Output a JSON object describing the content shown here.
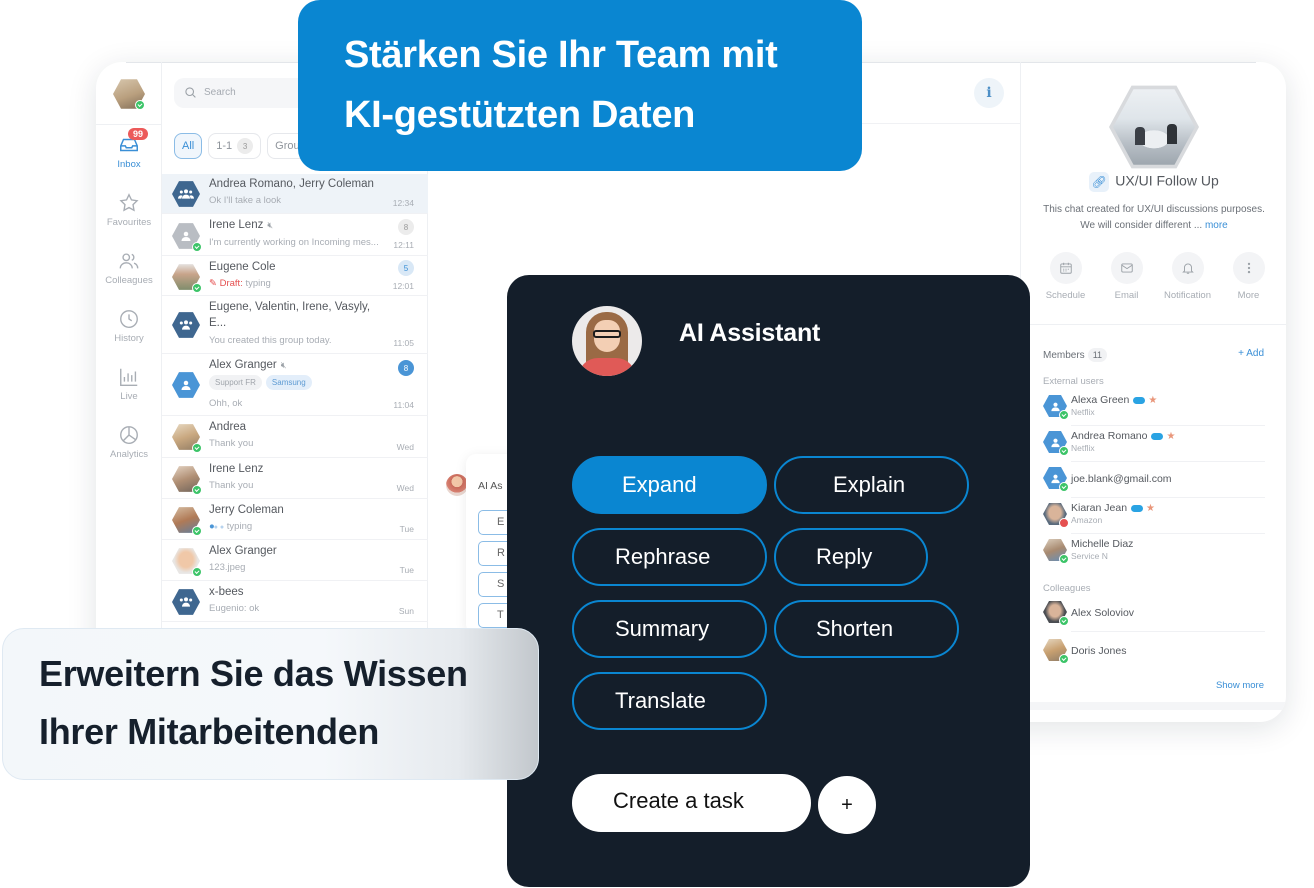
{
  "hero_top": {
    "line1": "Stärken Sie Ihr Team mit",
    "line2": "KI-gestützten Daten",
    "color": "#0a86d1"
  },
  "hero_bottom": {
    "line1": "Erweitern Sie das Wissen",
    "line2": "Ihrer Mitarbeitenden"
  },
  "rail": {
    "inbox_badge": "99",
    "items": [
      {
        "label": "Inbox",
        "icon": "inbox-icon"
      },
      {
        "label": "Favourites",
        "icon": "star-icon"
      },
      {
        "label": "Colleagues",
        "icon": "users-icon"
      },
      {
        "label": "History",
        "icon": "clock-icon"
      },
      {
        "label": "Live",
        "icon": "bar-chart-icon"
      },
      {
        "label": "Analytics",
        "icon": "pie-chart-icon"
      }
    ]
  },
  "list": {
    "search_placeholder": "Search",
    "filters": [
      {
        "label": "All"
      },
      {
        "label": "1-1",
        "count": "3"
      },
      {
        "label": "Grou"
      }
    ],
    "chats": [
      {
        "name": "Andrea Romano, Jerry Coleman",
        "preview": "Ok I'll take a look",
        "time": "12:34"
      },
      {
        "name": "Irene Lenz",
        "preview": "I'm currently working on Incoming mes...",
        "time": "12:11",
        "count": "8"
      },
      {
        "name": "Eugene Cole",
        "draft_label": "Draft:",
        "preview": "typing",
        "time": "12:01",
        "count": "5"
      },
      {
        "name": "Eugene, Valentin, Irene, Vasyly,",
        "name2": "E...",
        "preview": "You created this group today.",
        "time": "11:05"
      },
      {
        "name": "Alex Granger",
        "tags": [
          "Support FR",
          "Samsung"
        ],
        "preview": "Ohh, ok",
        "time": "11:04",
        "count": "8"
      },
      {
        "name": "Andrea",
        "preview": "Thank you",
        "time": "Wed"
      },
      {
        "name": "Irene Lenz",
        "preview": "Thank you",
        "time": "Wed"
      },
      {
        "name": "Jerry Coleman",
        "preview": "typing",
        "time": "Tue"
      },
      {
        "name": "Alex Granger",
        "preview": "123.jpeg",
        "time": "Tue"
      },
      {
        "name": "x-bees",
        "preview": "Eugenio: ok",
        "time": "Sun"
      }
    ]
  },
  "mini_popup": {
    "title": "AI As",
    "buttons": [
      "E",
      "R",
      "S",
      "T"
    ]
  },
  "panel": {
    "title": "UX/UI Follow Up",
    "desc_line1": "This chat created for UX/UI discussions purposes.",
    "desc_line2": "We will consider different ...",
    "more": "more",
    "actions": [
      {
        "label": "Schedule",
        "icon": "calendar-icon"
      },
      {
        "label": "Email",
        "icon": "envelope-icon"
      },
      {
        "label": "Notification",
        "icon": "bell-icon"
      },
      {
        "label": "More",
        "icon": "more-vertical-icon"
      }
    ],
    "members_label": "Members",
    "members_count": "11",
    "add_label": "+ Add",
    "external_label": "External users",
    "external": [
      {
        "name": "Alexa Green",
        "org": "Netflix",
        "status": "online"
      },
      {
        "name": "Andrea Romano",
        "org": "Netflix",
        "status": "online"
      },
      {
        "name": "joe.blank@gmail.com",
        "org": "",
        "status": "online"
      },
      {
        "name": "Kiaran Jean",
        "org": "Amazon",
        "status": "busy"
      },
      {
        "name": "Michelle Diaz",
        "org": "Service N",
        "status": "online"
      }
    ],
    "colleagues_label": "Colleagues",
    "colleagues": [
      {
        "name": "Alex Soloviov",
        "status": "online"
      },
      {
        "name": "Doris Jones",
        "status": "online"
      }
    ],
    "show_more": "Show more"
  },
  "ai": {
    "title": "AI Assistant",
    "actions": [
      "Expand",
      "Explain",
      "Rephrase",
      "Reply",
      "Summary",
      "Shorten",
      "Translate"
    ],
    "selected": "Expand",
    "create_task": "Create a task",
    "plus": "+",
    "bg_color": "#141e2a",
    "accent_color": "#0a86d1"
  }
}
